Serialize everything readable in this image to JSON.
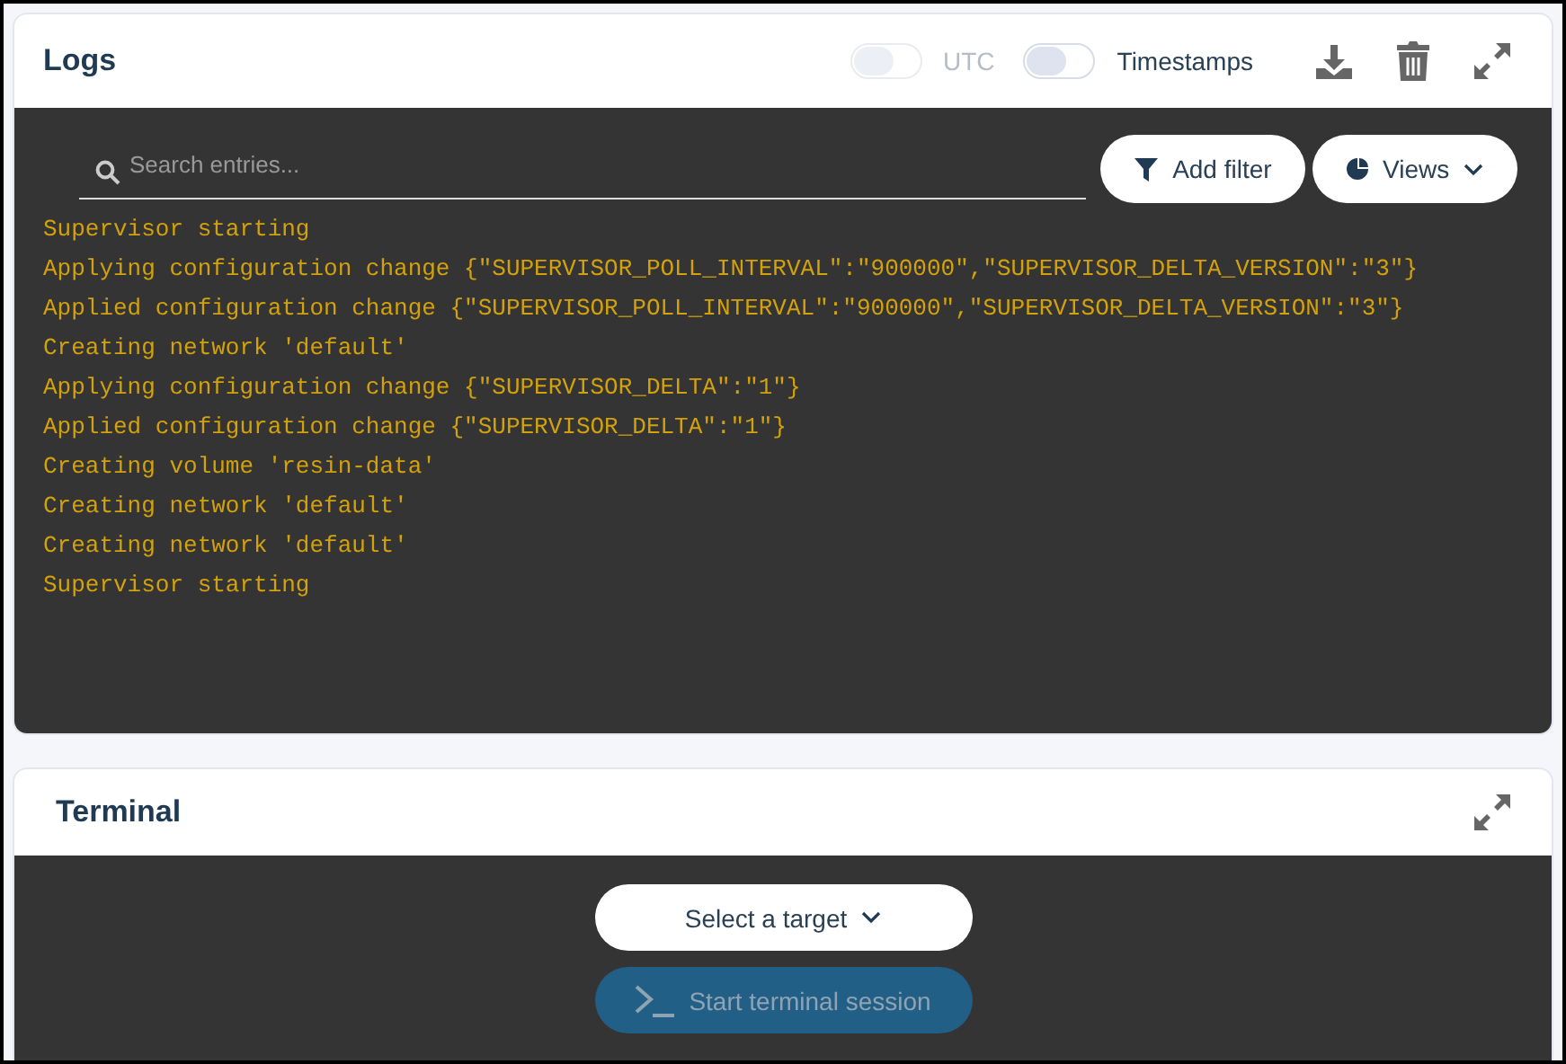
{
  "logs": {
    "title": "Logs",
    "toggles": [
      {
        "label": "UTC",
        "on": false,
        "disabled": true
      },
      {
        "label": "Timestamps",
        "on": false,
        "disabled": false
      }
    ],
    "search": {
      "placeholder": "Search entries..."
    },
    "add_filter": "Add filter",
    "views": "Views",
    "entries": [
      "Supervisor starting",
      "Applying configuration change {\"SUPERVISOR_POLL_INTERVAL\":\"900000\",\"SUPERVISOR_DELTA_VERSION\":\"3\"}",
      "Applied configuration change {\"SUPERVISOR_POLL_INTERVAL\":\"900000\",\"SUPERVISOR_DELTA_VERSION\":\"3\"}",
      "Creating network 'default'",
      "Applying configuration change {\"SUPERVISOR_DELTA\":\"1\"}",
      "Applied configuration change {\"SUPERVISOR_DELTA\":\"1\"}",
      "Creating volume 'resin-data'",
      "Creating network 'default'",
      "Creating network 'default'",
      "Supervisor starting"
    ]
  },
  "terminal": {
    "title": "Terminal",
    "target": "Select a target",
    "start": {
      "label": "Start terminal session",
      "disabled": true
    }
  }
}
